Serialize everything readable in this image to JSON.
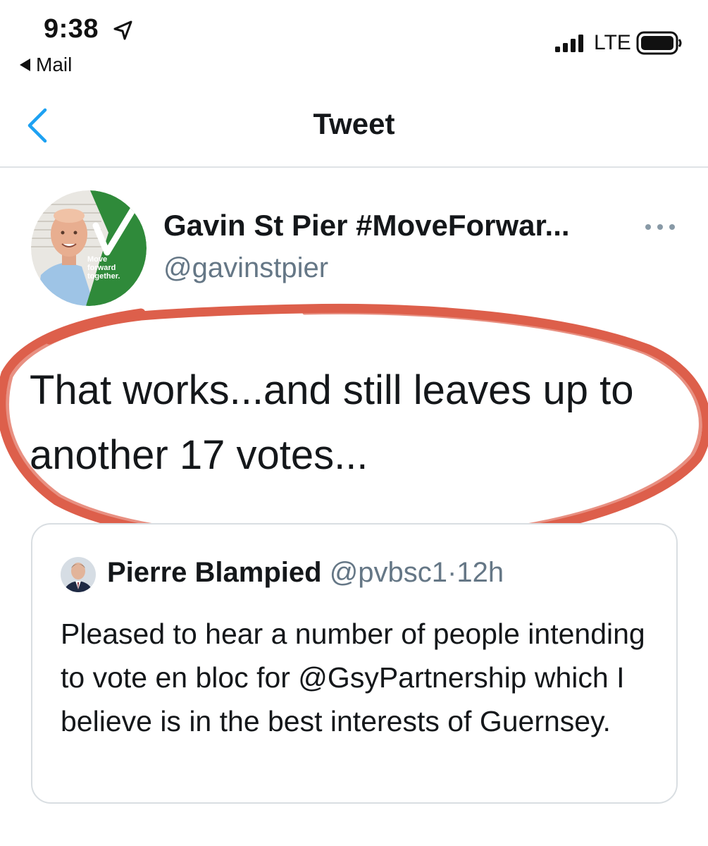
{
  "status_bar": {
    "time": "9:38",
    "back_app": "Mail",
    "network": "LTE"
  },
  "nav": {
    "title": "Tweet"
  },
  "tweet": {
    "author_name": "Gavin St Pier #MoveForwar...",
    "author_handle": "@gavinstpier",
    "avatar_badge_lines": [
      "Move",
      "forward",
      "together."
    ],
    "text": "That works...and still leaves up to another 17 votes..."
  },
  "quoted_tweet": {
    "author_name": "Pierre Blampied",
    "author_handle": "@pvbsc1",
    "separator": "·",
    "time": "12h",
    "text": "Pleased to hear a number of people intending to vote en bloc for @GsyPartnership which I believe is in the best interests of Guernsey."
  },
  "colors": {
    "link_blue": "#1da1f2",
    "secondary_gray": "#657786",
    "annotation_red": "#d94a33",
    "badge_green": "#2f8a3a"
  },
  "icons": {
    "nav_back": "chevron-left-icon",
    "more": "more-horizontal-icon",
    "location": "location-arrow-icon",
    "signal": "signal-bars-icon",
    "battery": "battery-icon"
  }
}
